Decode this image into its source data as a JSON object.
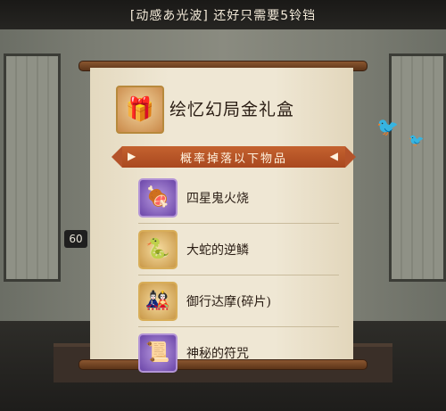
{
  "banner": {
    "text": "[动感あ光波] 还好只需要5铃铛"
  },
  "player": {
    "level": "60"
  },
  "gift": {
    "title": "绘忆幻局金礼盒",
    "icon": "gift-box-icon"
  },
  "drop_list": {
    "header": "概率掉落以下物品",
    "items": [
      {
        "name": "四星鬼火烧",
        "icon": "ghost-fire-barbecue-icon",
        "quality": "purple"
      },
      {
        "name": "大蛇的逆鳞",
        "icon": "serpent-scale-icon",
        "quality": "gold"
      },
      {
        "name": "御行达摩(碎片)",
        "icon": "daruma-fragment-icon",
        "quality": "gold"
      },
      {
        "name": "神秘的符咒",
        "icon": "mysterious-talisman-icon",
        "quality": "purple"
      }
    ]
  },
  "colors": {
    "drop_bar": "#b4532a",
    "scroll": "#efe7d4",
    "purple_frame": "#6b45a8",
    "gold_frame": "#c99848"
  }
}
